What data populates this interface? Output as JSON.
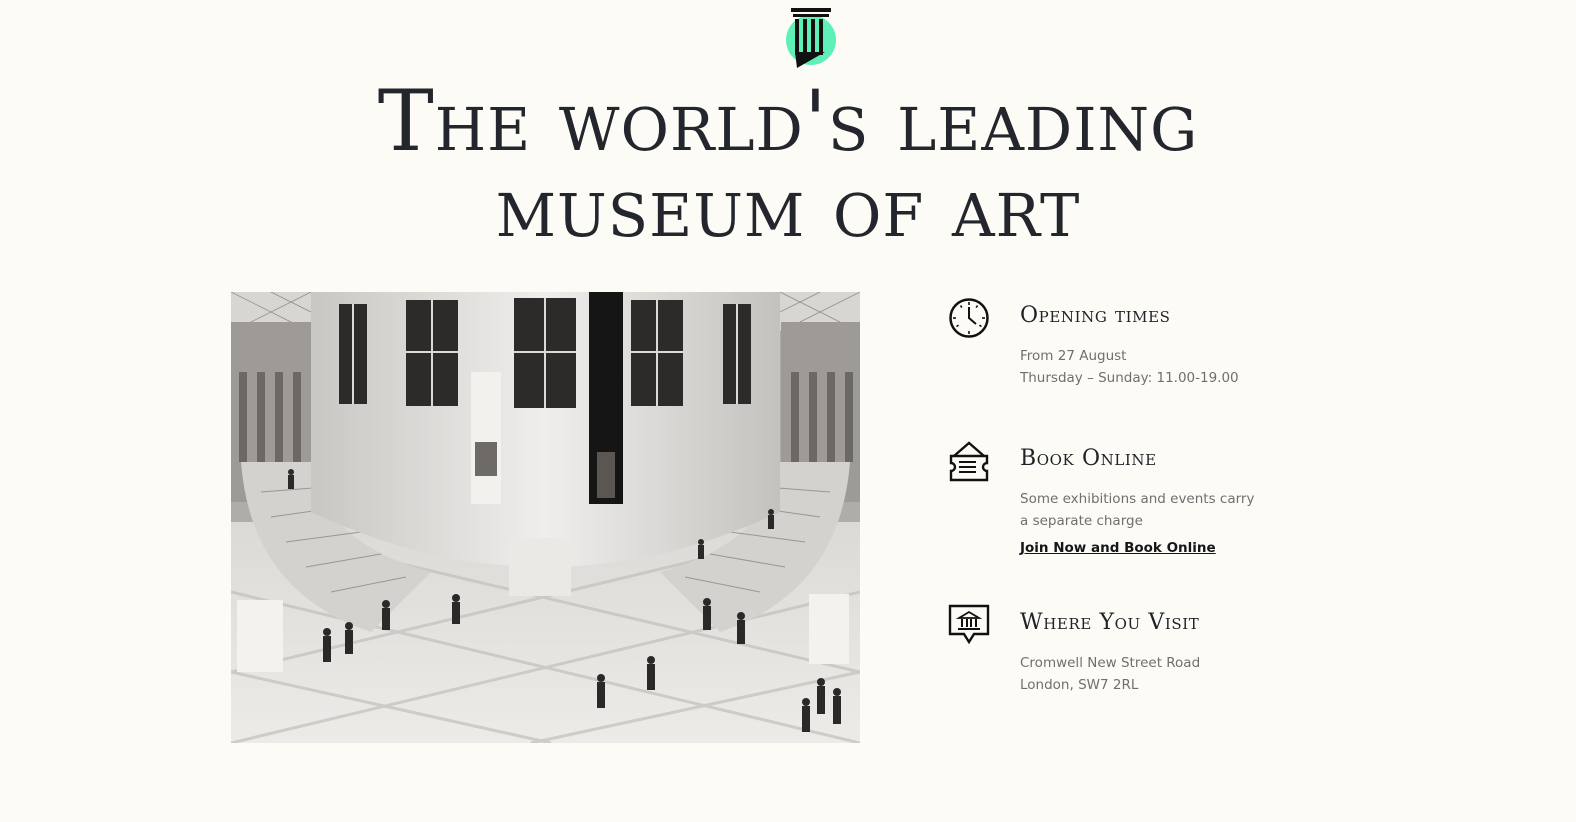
{
  "brand": {
    "logo_icon": "column-pillar-icon",
    "accent_color": "#5ef0b6"
  },
  "headline": {
    "line1": "The world's leading",
    "line2": "museum of art"
  },
  "hero": {
    "image_icon": "museum-atrium-photo"
  },
  "info": {
    "opening": {
      "icon": "clock-icon",
      "title": "Opening times",
      "line1": "From 27 August",
      "line2": "Thursday – Sunday: 11.00-19.00"
    },
    "book": {
      "icon": "ticket-icon",
      "title": "Book Online",
      "line1": "Some exhibitions and events carry",
      "line2": "a separate charge",
      "link": "Join Now and Book Online"
    },
    "visit": {
      "icon": "museum-location-icon",
      "title": "Where You Visit",
      "line1": "Cromwell New Street Road",
      "line2": "London, SW7 2RL"
    }
  }
}
